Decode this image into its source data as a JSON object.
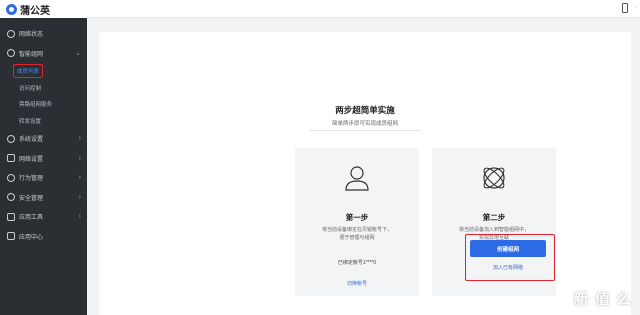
{
  "app": {
    "logo_text": "蒲公英"
  },
  "sidebar": {
    "items": [
      {
        "label": "网络状态",
        "icon": "globe-icon",
        "expanded": false
      },
      {
        "label": "智能组网",
        "icon": "network-icon",
        "expanded": true,
        "children": [
          {
            "label": "成员列表",
            "active": true
          },
          {
            "label": "访问控制",
            "active": false
          },
          {
            "label": "旁路组网服务",
            "active": false
          },
          {
            "label": "转发设置",
            "active": false
          }
        ]
      },
      {
        "label": "系统设置",
        "icon": "gear-icon"
      },
      {
        "label": "网络设置",
        "icon": "network-settings-icon"
      },
      {
        "label": "行为管理",
        "icon": "behavior-icon"
      },
      {
        "label": "安全管理",
        "icon": "shield-icon"
      },
      {
        "label": "应用工具",
        "icon": "tools-icon"
      },
      {
        "label": "应用中心",
        "icon": "apps-icon"
      }
    ]
  },
  "main": {
    "title": "两步超简单实施",
    "subtitle": "简单两步即可实现成员组网",
    "step1": {
      "heading": "第一步",
      "desc_line1": "将当前设备绑定在贝锐帐号下，",
      "desc_line2": "便于管理与组网",
      "bound_account": "已绑定帐号1****0",
      "switch_link": "切换帐号",
      "icon": "user-icon"
    },
    "step2": {
      "heading": "第二步",
      "desc_line1": "将当前设备加入到智能组网中，",
      "desc_line2": "实现异地互联",
      "create_button": "创建组网",
      "join_link": "加入已有网络",
      "icon": "orbit-icon"
    }
  },
  "watermark": "新 值 么",
  "colors": {
    "accent": "#2d6ae6",
    "highlight_border": "#e0232f",
    "sidebar_bg": "#2b2e33"
  }
}
